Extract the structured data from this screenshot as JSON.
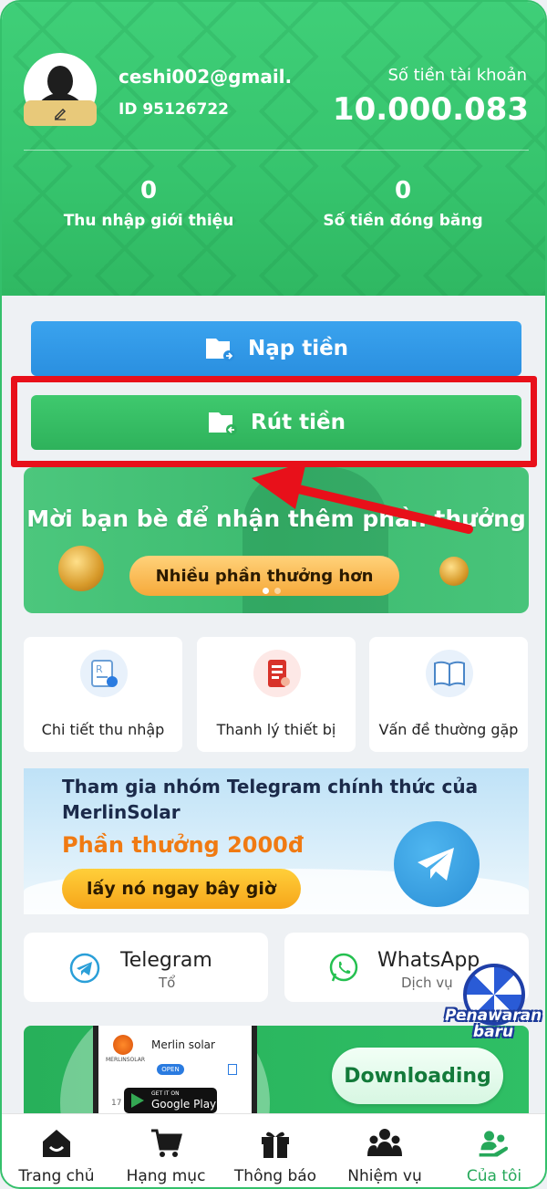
{
  "profile": {
    "email": "ceshi002@gmail.",
    "id_label": "ID 95126722",
    "balance_label": "Số tiền tài khoản",
    "balance_value": "10.000.083"
  },
  "stats": [
    {
      "value": "0",
      "label": "Thu nhập giới thiệu"
    },
    {
      "value": "0",
      "label": "Số tiền đóng băng"
    }
  ],
  "actions": {
    "deposit_label": "Nạp tiền",
    "withdraw_label": "Rút tiền"
  },
  "invite_banner": {
    "title": "Mời bạn bè để nhận thêm phần thưởng",
    "button_label": "Nhiều phần thưởng hơn"
  },
  "feature_cards": [
    {
      "label": "Chi tiết thu nhập",
      "icon": "report-icon"
    },
    {
      "label": "Thanh lý thiết bị",
      "icon": "phone-touch-icon"
    },
    {
      "label": "Vấn đề thường gặp",
      "icon": "book-icon"
    }
  ],
  "telegram_banner": {
    "line1": "Tham gia nhóm Telegram chính thức của",
    "line2": "MerlinSolar",
    "reward": "Phần thưởng 2000đ",
    "button_label": "lấy nó ngay bây giờ"
  },
  "contacts": [
    {
      "name": "Telegram",
      "sub": "Tổ",
      "icon": "telegram-icon",
      "color": "#2a9fd8"
    },
    {
      "name": "WhatsApp",
      "sub": "Dịch vụ",
      "icon": "whatsapp-icon",
      "color": "#25c050"
    }
  ],
  "promo_badge": {
    "line1": "Penawaran",
    "line2": "baru"
  },
  "download_banner": {
    "app_name": "Merlin solar",
    "brand_small": "MERLINSOLAR",
    "open_label": "OPEN",
    "get_it_on": "GET IT ON",
    "store": "Google Play",
    "number": "17",
    "button_label": "Downloading"
  },
  "nav": [
    {
      "label": "Trang chủ",
      "icon": "home-icon",
      "active": false
    },
    {
      "label": "Hạng mục",
      "icon": "cart-icon",
      "active": false
    },
    {
      "label": "Thông báo",
      "icon": "gift-icon",
      "active": false
    },
    {
      "label": "Nhiệm vụ",
      "icon": "team-icon",
      "active": false
    },
    {
      "label": "Của tôi",
      "icon": "user-icon",
      "active": true
    }
  ],
  "colors": {
    "primary_green": "#36c46d",
    "deposit_blue": "#2a8fe0",
    "highlight_red": "#e8101a",
    "active_nav": "#26a85a"
  }
}
